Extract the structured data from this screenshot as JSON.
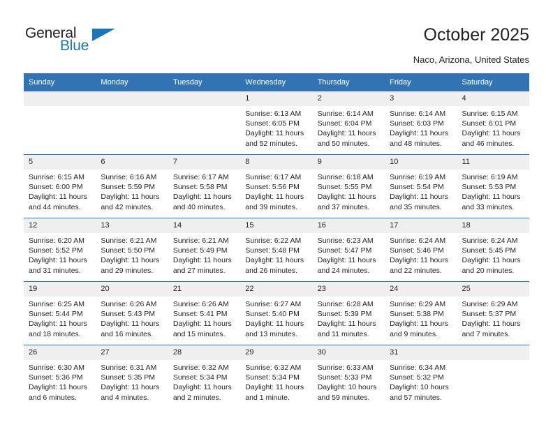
{
  "brand": {
    "name_part1": "General",
    "name_part2": "Blue",
    "accent_color": "#1b75bb"
  },
  "header": {
    "title": "October 2025",
    "location": "Naco, Arizona, United States"
  },
  "theme": {
    "header_row_color": "#3273b4",
    "daynum_band_color": "#efefef",
    "text_color": "#231f20"
  },
  "columns": [
    "Sunday",
    "Monday",
    "Tuesday",
    "Wednesday",
    "Thursday",
    "Friday",
    "Saturday"
  ],
  "labels": {
    "sunrise_prefix": "Sunrise:",
    "sunset_prefix": "Sunset:",
    "daylight_prefix": "Daylight:"
  },
  "weeks": [
    [
      {
        "day": "",
        "empty": true,
        "line1": "",
        "line2": "",
        "line3": "",
        "line4": ""
      },
      {
        "day": "",
        "empty": true,
        "line1": "",
        "line2": "",
        "line3": "",
        "line4": ""
      },
      {
        "day": "",
        "empty": true,
        "line1": "",
        "line2": "",
        "line3": "",
        "line4": ""
      },
      {
        "day": "1",
        "empty": false,
        "line1": "Sunrise: 6:13 AM",
        "line2": "Sunset: 6:05 PM",
        "line3": "Daylight: 11 hours",
        "line4": "and 52 minutes."
      },
      {
        "day": "2",
        "empty": false,
        "line1": "Sunrise: 6:14 AM",
        "line2": "Sunset: 6:04 PM",
        "line3": "Daylight: 11 hours",
        "line4": "and 50 minutes."
      },
      {
        "day": "3",
        "empty": false,
        "line1": "Sunrise: 6:14 AM",
        "line2": "Sunset: 6:03 PM",
        "line3": "Daylight: 11 hours",
        "line4": "and 48 minutes."
      },
      {
        "day": "4",
        "empty": false,
        "line1": "Sunrise: 6:15 AM",
        "line2": "Sunset: 6:01 PM",
        "line3": "Daylight: 11 hours",
        "line4": "and 46 minutes."
      }
    ],
    [
      {
        "day": "5",
        "empty": false,
        "line1": "Sunrise: 6:15 AM",
        "line2": "Sunset: 6:00 PM",
        "line3": "Daylight: 11 hours",
        "line4": "and 44 minutes."
      },
      {
        "day": "6",
        "empty": false,
        "line1": "Sunrise: 6:16 AM",
        "line2": "Sunset: 5:59 PM",
        "line3": "Daylight: 11 hours",
        "line4": "and 42 minutes."
      },
      {
        "day": "7",
        "empty": false,
        "line1": "Sunrise: 6:17 AM",
        "line2": "Sunset: 5:58 PM",
        "line3": "Daylight: 11 hours",
        "line4": "and 40 minutes."
      },
      {
        "day": "8",
        "empty": false,
        "line1": "Sunrise: 6:17 AM",
        "line2": "Sunset: 5:56 PM",
        "line3": "Daylight: 11 hours",
        "line4": "and 39 minutes."
      },
      {
        "day": "9",
        "empty": false,
        "line1": "Sunrise: 6:18 AM",
        "line2": "Sunset: 5:55 PM",
        "line3": "Daylight: 11 hours",
        "line4": "and 37 minutes."
      },
      {
        "day": "10",
        "empty": false,
        "line1": "Sunrise: 6:19 AM",
        "line2": "Sunset: 5:54 PM",
        "line3": "Daylight: 11 hours",
        "line4": "and 35 minutes."
      },
      {
        "day": "11",
        "empty": false,
        "line1": "Sunrise: 6:19 AM",
        "line2": "Sunset: 5:53 PM",
        "line3": "Daylight: 11 hours",
        "line4": "and 33 minutes."
      }
    ],
    [
      {
        "day": "12",
        "empty": false,
        "line1": "Sunrise: 6:20 AM",
        "line2": "Sunset: 5:52 PM",
        "line3": "Daylight: 11 hours",
        "line4": "and 31 minutes."
      },
      {
        "day": "13",
        "empty": false,
        "line1": "Sunrise: 6:21 AM",
        "line2": "Sunset: 5:50 PM",
        "line3": "Daylight: 11 hours",
        "line4": "and 29 minutes."
      },
      {
        "day": "14",
        "empty": false,
        "line1": "Sunrise: 6:21 AM",
        "line2": "Sunset: 5:49 PM",
        "line3": "Daylight: 11 hours",
        "line4": "and 27 minutes."
      },
      {
        "day": "15",
        "empty": false,
        "line1": "Sunrise: 6:22 AM",
        "line2": "Sunset: 5:48 PM",
        "line3": "Daylight: 11 hours",
        "line4": "and 26 minutes."
      },
      {
        "day": "16",
        "empty": false,
        "line1": "Sunrise: 6:23 AM",
        "line2": "Sunset: 5:47 PM",
        "line3": "Daylight: 11 hours",
        "line4": "and 24 minutes."
      },
      {
        "day": "17",
        "empty": false,
        "line1": "Sunrise: 6:24 AM",
        "line2": "Sunset: 5:46 PM",
        "line3": "Daylight: 11 hours",
        "line4": "and 22 minutes."
      },
      {
        "day": "18",
        "empty": false,
        "line1": "Sunrise: 6:24 AM",
        "line2": "Sunset: 5:45 PM",
        "line3": "Daylight: 11 hours",
        "line4": "and 20 minutes."
      }
    ],
    [
      {
        "day": "19",
        "empty": false,
        "line1": "Sunrise: 6:25 AM",
        "line2": "Sunset: 5:44 PM",
        "line3": "Daylight: 11 hours",
        "line4": "and 18 minutes."
      },
      {
        "day": "20",
        "empty": false,
        "line1": "Sunrise: 6:26 AM",
        "line2": "Sunset: 5:43 PM",
        "line3": "Daylight: 11 hours",
        "line4": "and 16 minutes."
      },
      {
        "day": "21",
        "empty": false,
        "line1": "Sunrise: 6:26 AM",
        "line2": "Sunset: 5:41 PM",
        "line3": "Daylight: 11 hours",
        "line4": "and 15 minutes."
      },
      {
        "day": "22",
        "empty": false,
        "line1": "Sunrise: 6:27 AM",
        "line2": "Sunset: 5:40 PM",
        "line3": "Daylight: 11 hours",
        "line4": "and 13 minutes."
      },
      {
        "day": "23",
        "empty": false,
        "line1": "Sunrise: 6:28 AM",
        "line2": "Sunset: 5:39 PM",
        "line3": "Daylight: 11 hours",
        "line4": "and 11 minutes."
      },
      {
        "day": "24",
        "empty": false,
        "line1": "Sunrise: 6:29 AM",
        "line2": "Sunset: 5:38 PM",
        "line3": "Daylight: 11 hours",
        "line4": "and 9 minutes."
      },
      {
        "day": "25",
        "empty": false,
        "line1": "Sunrise: 6:29 AM",
        "line2": "Sunset: 5:37 PM",
        "line3": "Daylight: 11 hours",
        "line4": "and 7 minutes."
      }
    ],
    [
      {
        "day": "26",
        "empty": false,
        "line1": "Sunrise: 6:30 AM",
        "line2": "Sunset: 5:36 PM",
        "line3": "Daylight: 11 hours",
        "line4": "and 6 minutes."
      },
      {
        "day": "27",
        "empty": false,
        "line1": "Sunrise: 6:31 AM",
        "line2": "Sunset: 5:35 PM",
        "line3": "Daylight: 11 hours",
        "line4": "and 4 minutes."
      },
      {
        "day": "28",
        "empty": false,
        "line1": "Sunrise: 6:32 AM",
        "line2": "Sunset: 5:34 PM",
        "line3": "Daylight: 11 hours",
        "line4": "and 2 minutes."
      },
      {
        "day": "29",
        "empty": false,
        "line1": "Sunrise: 6:32 AM",
        "line2": "Sunset: 5:34 PM",
        "line3": "Daylight: 11 hours",
        "line4": "and 1 minute."
      },
      {
        "day": "30",
        "empty": false,
        "line1": "Sunrise: 6:33 AM",
        "line2": "Sunset: 5:33 PM",
        "line3": "Daylight: 10 hours",
        "line4": "and 59 minutes."
      },
      {
        "day": "31",
        "empty": false,
        "line1": "Sunrise: 6:34 AM",
        "line2": "Sunset: 5:32 PM",
        "line3": "Daylight: 10 hours",
        "line4": "and 57 minutes."
      },
      {
        "day": "",
        "empty": true,
        "line1": "",
        "line2": "",
        "line3": "",
        "line4": ""
      }
    ]
  ]
}
